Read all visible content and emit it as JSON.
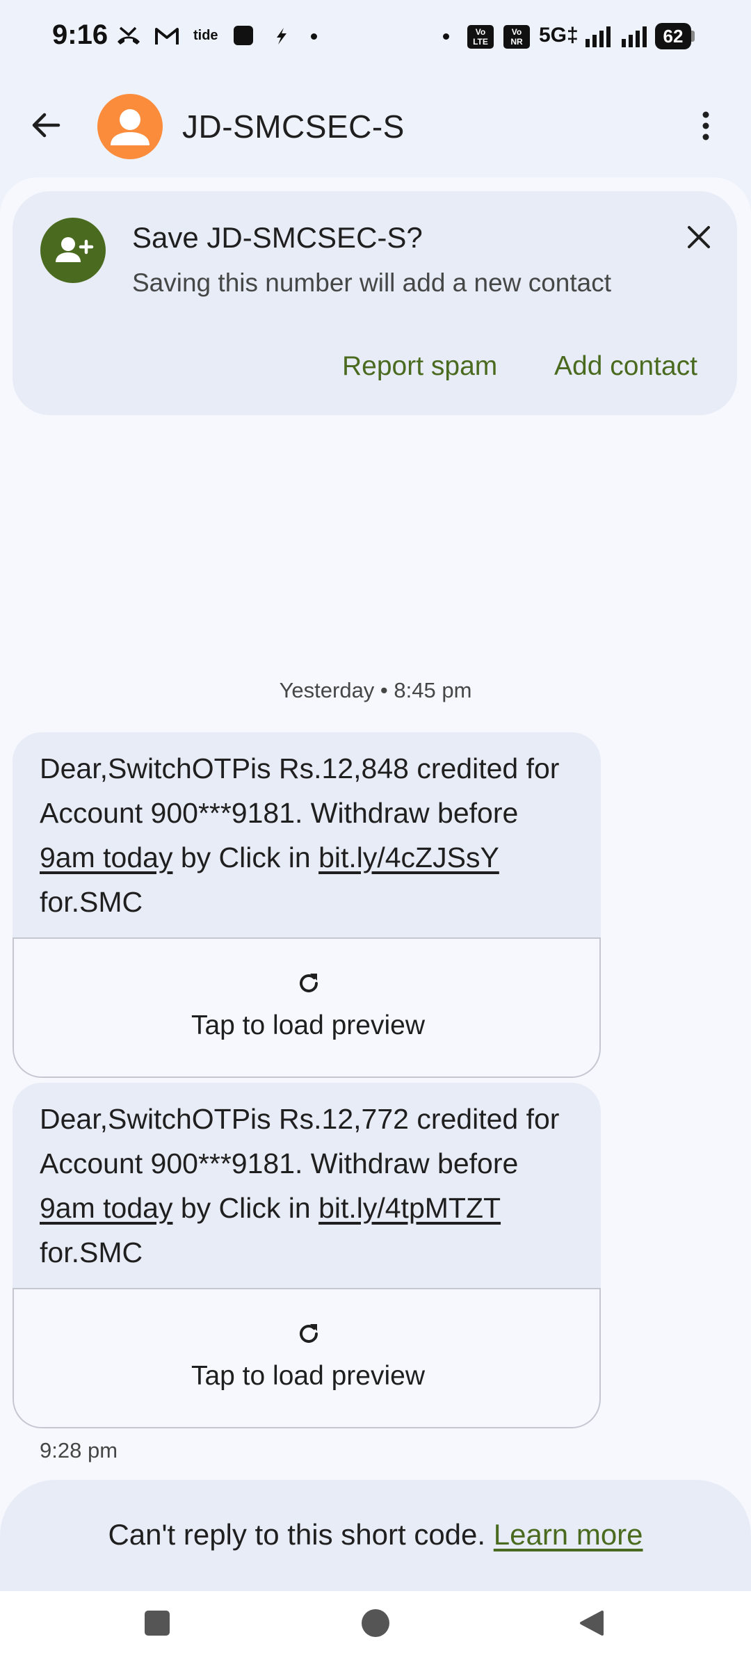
{
  "status_bar": {
    "time": "9:16",
    "network": "5G‡",
    "battery": "62",
    "sim1_badge_top": "Vo",
    "sim1_badge_bottom": "LTE",
    "sim2_badge_top": "Vo",
    "sim2_badge_bottom": "NR",
    "notification_label": "tide"
  },
  "app_bar": {
    "title": "JD-SMCSEC-S"
  },
  "save_card": {
    "title": "Save JD-SMCSEC-S?",
    "subtitle": "Saving this number will add a new contact",
    "report_spam": "Report spam",
    "add_contact": "Add contact"
  },
  "conversation": {
    "timestamp": "Yesterday • 8:45 pm",
    "messages": [
      {
        "line1": "Dear,SwitchOTPis Rs.12,848 credited for",
        "line2": "Account 900***9181. Withdraw before",
        "link_time": "9am today",
        "mid": " by Click in ",
        "link_url": "bit.ly/4cZJSsY",
        "line4": "for.SMC",
        "preview": "Tap to load preview"
      },
      {
        "line1": "Dear,SwitchOTPis Rs.12,772 credited for",
        "line2": "Account 900***9181. Withdraw before",
        "link_time": "9am today",
        "mid": " by Click in ",
        "link_url": "bit.ly/4tpMTZT",
        "line4": "for.SMC",
        "preview": "Tap to load preview"
      }
    ],
    "last_time": "9:28 pm"
  },
  "footer": {
    "text": "Can't reply to this short code. ",
    "learn_more": "Learn more"
  },
  "colors": {
    "accent_green": "#4a6b1f",
    "avatar_orange": "#fb8c3c",
    "surface": "#f6f8fe",
    "card": "#e8ecf6"
  }
}
